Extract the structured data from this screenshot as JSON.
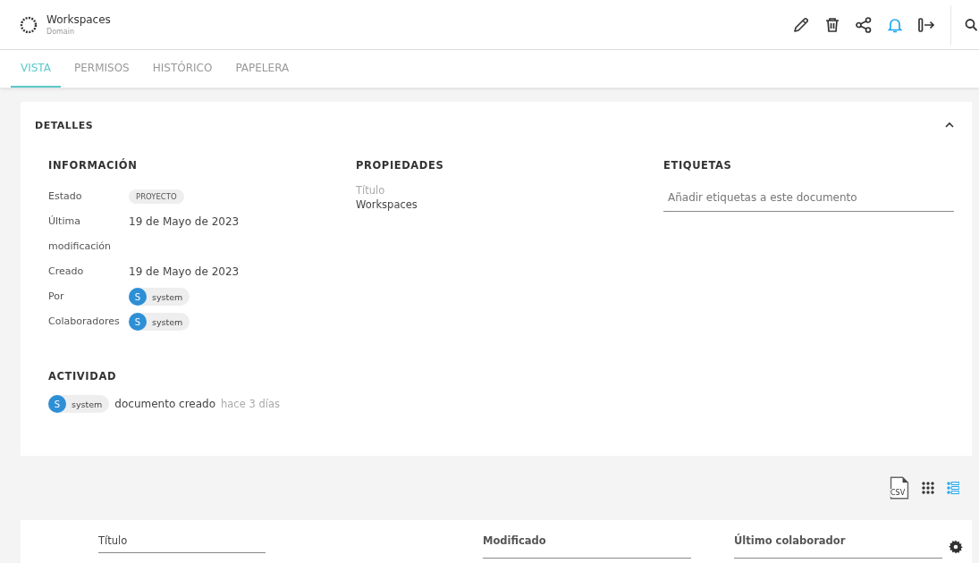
{
  "header": {
    "title": "Workspaces",
    "subtitle": "Domain",
    "notifications_on": true
  },
  "tabs": [
    {
      "label": "VISTA",
      "selected": true
    },
    {
      "label": "PERMISOS",
      "selected": false
    },
    {
      "label": "HISTÓRICO",
      "selected": false
    },
    {
      "label": "PAPELERA",
      "selected": false
    }
  ],
  "details": {
    "title": "DETALLES",
    "expanded": true,
    "information": {
      "title": "INFORMACIÓN",
      "rows": [
        {
          "kind": "tag",
          "label": "Estado",
          "value": "PROYECTO"
        },
        {
          "kind": "text",
          "label": "Última modificación",
          "value": "19 de Mayo de 2023"
        },
        {
          "kind": "text",
          "label": "Creado",
          "value": "19 de Mayo de 2023"
        },
        {
          "kind": "user",
          "label": "Por",
          "initial": "S",
          "value": "system"
        },
        {
          "kind": "user",
          "label": "Colaboradores",
          "initial": "S",
          "value": "system"
        }
      ]
    },
    "properties": {
      "title": "PROPIEDADES",
      "items": [
        {
          "label": "Título",
          "value": "Workspaces"
        }
      ]
    },
    "tags": {
      "title": "ETIQUETAS",
      "placeholder": "Añadir etiquetas a este documento"
    },
    "activity": {
      "title": "ACTIVIDAD",
      "items": [
        {
          "initial": "S",
          "user": "system",
          "action": "documento creado",
          "time": "hace 3 días"
        }
      ]
    }
  },
  "toolbar": {
    "csv_label": "CSV",
    "views": [
      {
        "kind": "grid",
        "selected": false
      },
      {
        "kind": "list",
        "selected": true
      }
    ]
  },
  "table": {
    "columns": [
      {
        "label": "Título",
        "bold": false
      },
      {
        "label": "Modificado",
        "bold": true
      },
      {
        "label": "Último colaborador",
        "bold": true
      }
    ]
  }
}
